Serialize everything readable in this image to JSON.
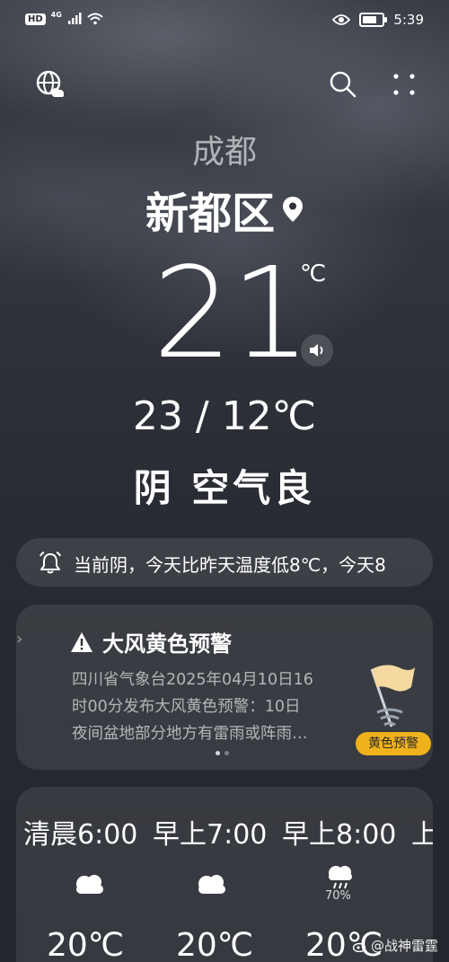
{
  "status_bar": {
    "hd": "HD",
    "network": "4G",
    "time": "5:39",
    "battery_percent": 75
  },
  "header": {
    "city": "成都",
    "district": "新都区"
  },
  "current": {
    "temperature": "21",
    "unit": "℃",
    "range": "23 / 12℃",
    "condition": "阴 空气良"
  },
  "ticker": {
    "text": "当前阴，今天比昨天温度低8℃，今天8"
  },
  "alert": {
    "title": "大风黄色预警",
    "body_lines": [
      "四川省气象台2025年04月10日16",
      "时00分发布大风黄色预警：10日",
      "夜间盆地部分地方有雷雨或阵雨…"
    ],
    "badge": "黄色预警",
    "badge_color": "#f0b21c",
    "pages": 2,
    "active_page": 1
  },
  "hourly": [
    {
      "time": "清晨6:00",
      "icon": "cloudy-icon",
      "precip": "",
      "temp": "20℃"
    },
    {
      "time": "早上7:00",
      "icon": "cloudy-icon",
      "precip": "",
      "temp": "20℃"
    },
    {
      "time": "早上8:00",
      "icon": "rain-cloud-icon",
      "precip": "70%",
      "temp": "20℃"
    },
    {
      "time": "上",
      "icon": "",
      "precip": "",
      "temp": ""
    }
  ],
  "watermark": "@战神雷霆"
}
